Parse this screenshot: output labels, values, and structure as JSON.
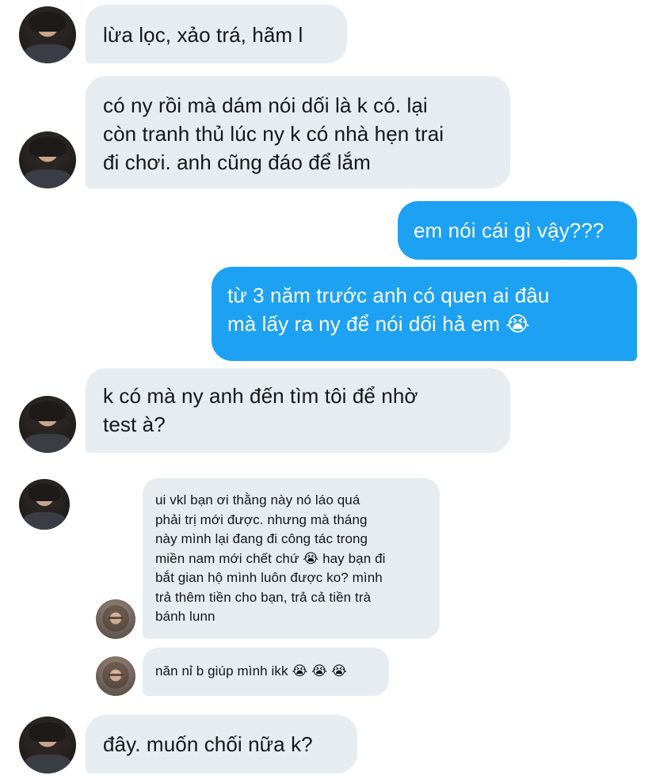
{
  "messages": [
    {
      "id": "m1",
      "direction": "incoming",
      "text": "lừa lọc, xảo trá, hãm l"
    },
    {
      "id": "m2",
      "direction": "incoming",
      "text": "có ny rồi mà dám nói dối là k có. lại\ncòn tranh thủ lúc ny k có nhà hẹn trai\nđi chơi. anh cũng đáo để lắm"
    },
    {
      "id": "m3",
      "direction": "outgoing",
      "text": "em nói cái gì vậy???"
    },
    {
      "id": "m4",
      "direction": "outgoing",
      "text": "từ 3 năm trước anh có quen ai đâu\nmà lấy ra ny để nói dối hả em 😭"
    },
    {
      "id": "m5",
      "direction": "incoming",
      "text": "k có mà ny anh đến tìm tôi để nhờ\ntest à?"
    },
    {
      "id": "m6",
      "direction": "forwarded",
      "text": "ui vkl bạn ơi thằng này nó láo quá\nphải trị mới được. nhưng mà tháng\nnày mình lại đang đi công tác trong\nmiền nam mới chết chứ 😭 hay bạn đi\nbắt gian hộ mình luôn được ko? mình\ntrả thêm tiền cho bạn, trả cả tiền trà\nbánh lunn"
    },
    {
      "id": "m7",
      "direction": "forwarded",
      "text": "năn nỉ b giúp mình ikk 😭 😭 😭"
    },
    {
      "id": "m8",
      "direction": "incoming",
      "text": "đây. muốn chối nữa k?"
    }
  ],
  "colors": {
    "incoming_bubble": "#e6ecf0",
    "outgoing_bubble": "#1da1f2",
    "incoming_text": "#14171a",
    "outgoing_text": "#ffffff"
  }
}
